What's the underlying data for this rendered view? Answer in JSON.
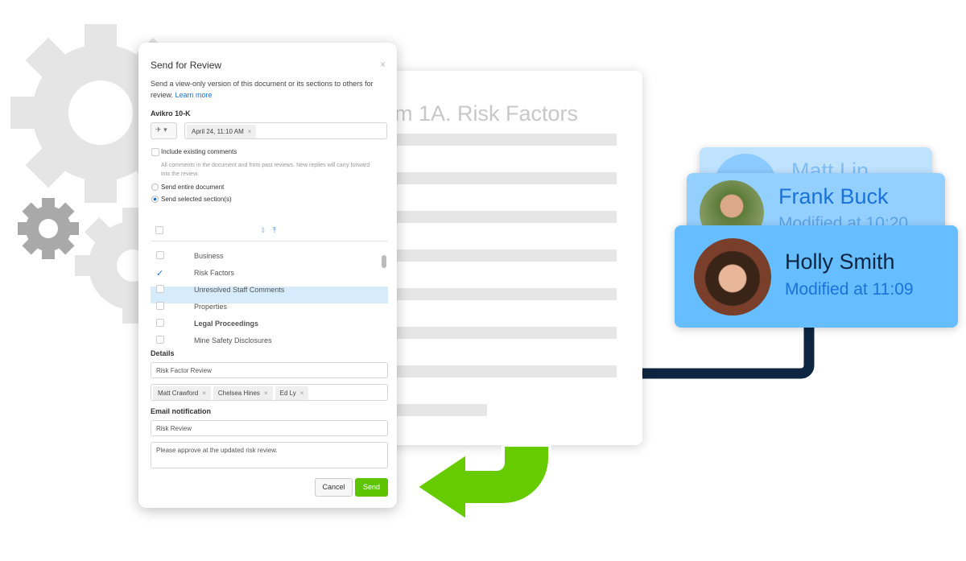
{
  "document": {
    "title": "m 1A. Risk Factors"
  },
  "dialog": {
    "title": "Send for Review",
    "description": "Send a view-only version of this document or its sections to others for review.",
    "learn_more": "Learn more",
    "doc_name": "Avikro 10-K",
    "version_chip": "April 24, 11:10 AM",
    "include_comments_label": "Include existing comments",
    "include_comments_help": "All comments in the document and from past reviews. New replies will carry forward into the review.",
    "send_entire_label": "Send entire document",
    "send_selected_label": "Send selected section(s)",
    "sections": [
      {
        "label": "Business",
        "checked": false
      },
      {
        "label": "Risk Factors",
        "checked": true
      },
      {
        "label": "Unresolved Staff Comments",
        "checked": false
      },
      {
        "label": "Properties",
        "checked": false
      },
      {
        "label": "Legal Proceedings",
        "checked": false,
        "highlighted": true
      },
      {
        "label": "Mine Safety Disclosures",
        "checked": false
      }
    ],
    "details_label": "Details",
    "review_name": "Risk Factor Review",
    "reviewers": [
      "Matt Crawford",
      "Chelsea Hines",
      "Ed Ly"
    ],
    "email_label": "Email notification",
    "email_subject": "Risk Review",
    "email_message": "Please approve at the updated risk review.",
    "cancel": "Cancel",
    "send": "Send"
  },
  "cards": [
    {
      "name": "Matt Lin",
      "modified": ""
    },
    {
      "name": "Frank Buck",
      "modified": "Modified at 10:20"
    },
    {
      "name": "Holly Smith",
      "modified": "Modified at 11:09"
    }
  ],
  "colors": {
    "accent": "#1a73d9",
    "send": "#5ec400",
    "arrow": "#66cc00",
    "connector": "#0d2540",
    "card": "#66bdff"
  }
}
